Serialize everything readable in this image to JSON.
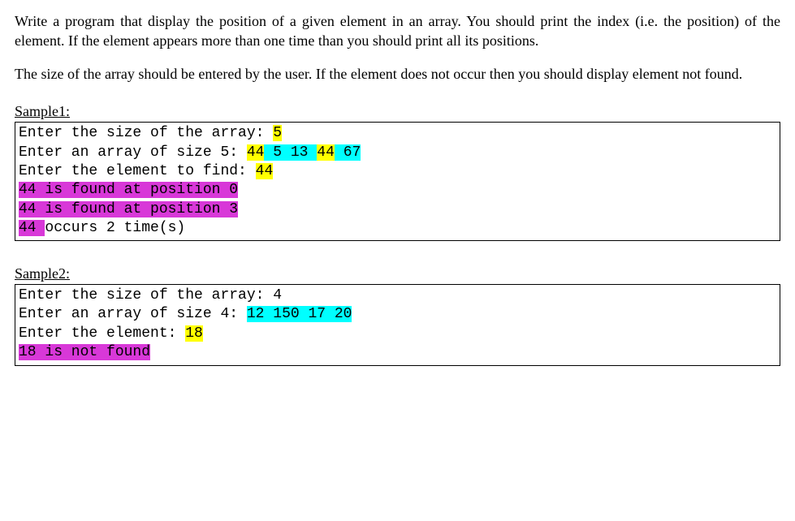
{
  "paragraph1": "Write a program that display the position of a given element in an array. You should print the index (i.e. the position) of the element. If the element appears more than one time than you should print all its positions.",
  "paragraph2": "The size of the array should be entered by the user. If the element does not occur then you should display element not found.",
  "sample1": {
    "label": "Sample1:",
    "line1_prefix": "Enter the size of the array: ",
    "line1_value": "5",
    "line2_prefix": "Enter an array of size 5: ",
    "line2_v1": "44",
    "line2_v2": " 5",
    "line2_v3": " 13 ",
    "line2_v4": "44",
    "line2_v5": " 67",
    "line3_prefix": "Enter the element to find: ",
    "line3_value": "44",
    "line4": "44 is found at position 0",
    "line5": "44 is found at position 3",
    "line6_part1": "44 ",
    "line6_part2": "occurs 2 time(s)"
  },
  "sample2": {
    "label": "Sample2:",
    "line1_prefix": "Enter the size of the array: ",
    "line1_value": "4",
    "line2_prefix": "Enter an array of size 4: ",
    "line2_value": "12 150 17 20",
    "line3_prefix": "Enter the element: ",
    "line3_value": "18",
    "line4": "18 is not found"
  }
}
